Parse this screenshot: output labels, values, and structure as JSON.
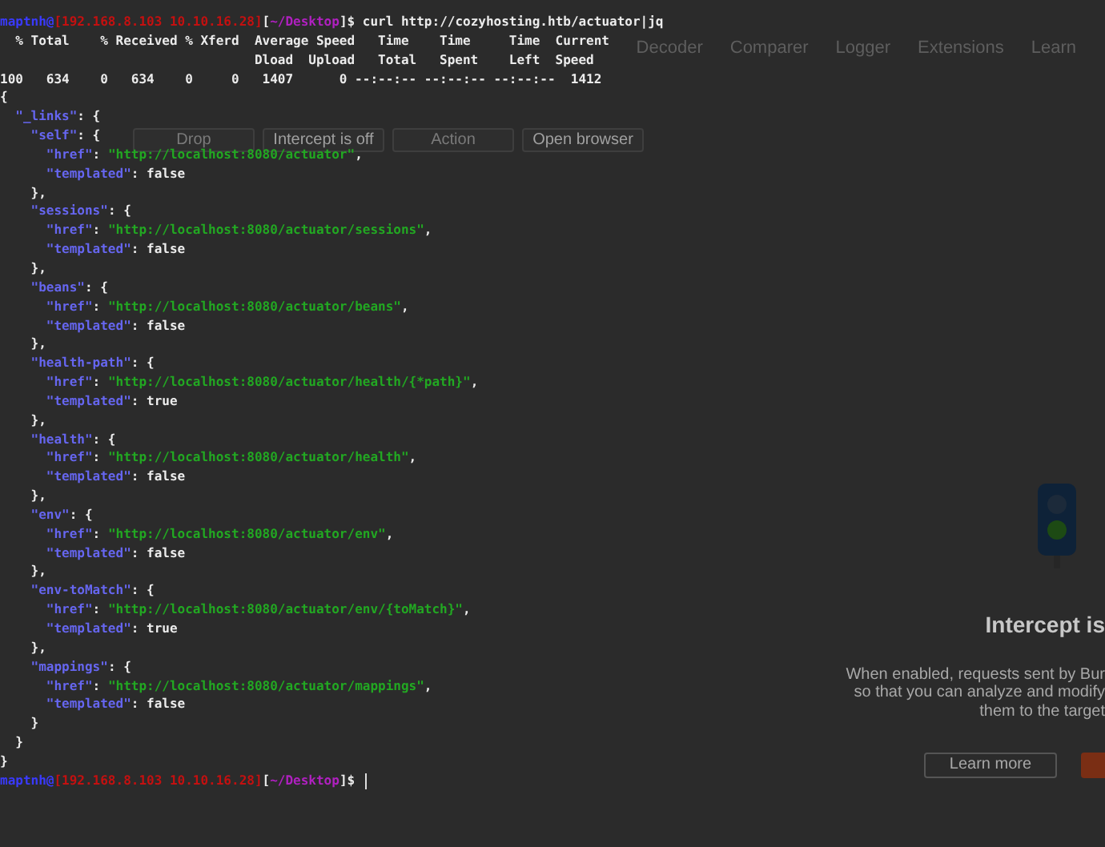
{
  "burp": {
    "tabs": [
      {
        "label": "Decoder",
        "selected": false
      },
      {
        "label": "Comparer",
        "selected": false
      },
      {
        "label": "Logger",
        "selected": false
      },
      {
        "label": "Extensions",
        "selected": false
      },
      {
        "label": "Learn",
        "selected": false
      }
    ],
    "buttons": [
      {
        "label": "Drop",
        "disabled": true
      },
      {
        "label": "Intercept is off",
        "disabled": false
      },
      {
        "label": "Action",
        "disabled": true
      },
      {
        "label": "Open browser",
        "disabled": false
      }
    ],
    "intercept_panel": {
      "title": "Intercept is",
      "description": [
        "When enabled, requests sent by Bur",
        "so that you can analyze and modify",
        "them to the target"
      ],
      "learn_more": "Learn more"
    }
  },
  "terminal": {
    "lines": [
      [
        {
          "kind": "user",
          "text": "maptnh@"
        },
        {
          "kind": "host",
          "text": "[192.168.8.103 10.10.16.28]"
        },
        {
          "kind": "plain",
          "text": "["
        },
        {
          "kind": "path",
          "text": "~/Desktop"
        },
        {
          "kind": "plain",
          "text": "]$ curl http://cozyhosting.htb/actuator|jq"
        }
      ],
      [
        {
          "kind": "plain",
          "text": "  % Total    % Received % Xferd  Average Speed   Time    Time     Time  Current"
        }
      ],
      [
        {
          "kind": "plain",
          "text": "                                 Dload  Upload   Total   Spent    Left  Speed"
        }
      ],
      [
        {
          "kind": "plain",
          "text": "100   634    0   634    0     0   1407      0 --:--:-- --:--:-- --:--:--  1412"
        }
      ],
      [
        {
          "kind": "plain",
          "text": "{"
        }
      ],
      [
        {
          "kind": "key",
          "text": "  \"_links\""
        },
        {
          "kind": "plain",
          "text": ": {"
        }
      ],
      [
        {
          "kind": "key",
          "text": "    \"self\""
        },
        {
          "kind": "plain",
          "text": ": {"
        }
      ],
      [
        {
          "kind": "key",
          "text": "      \"href\""
        },
        {
          "kind": "plain",
          "text": ": "
        },
        {
          "kind": "string",
          "text": "\"http://localhost:8080/actuator\""
        },
        {
          "kind": "plain",
          "text": ","
        }
      ],
      [
        {
          "kind": "key",
          "text": "      \"templated\""
        },
        {
          "kind": "plain",
          "text": ": false"
        }
      ],
      [
        {
          "kind": "plain",
          "text": "    },"
        }
      ],
      [
        {
          "kind": "key",
          "text": "    \"sessions\""
        },
        {
          "kind": "plain",
          "text": ": {"
        }
      ],
      [
        {
          "kind": "key",
          "text": "      \"href\""
        },
        {
          "kind": "plain",
          "text": ": "
        },
        {
          "kind": "string",
          "text": "\"http://localhost:8080/actuator/sessions\""
        },
        {
          "kind": "plain",
          "text": ","
        }
      ],
      [
        {
          "kind": "key",
          "text": "      \"templated\""
        },
        {
          "kind": "plain",
          "text": ": false"
        }
      ],
      [
        {
          "kind": "plain",
          "text": "    },"
        }
      ],
      [
        {
          "kind": "key",
          "text": "    \"beans\""
        },
        {
          "kind": "plain",
          "text": ": {"
        }
      ],
      [
        {
          "kind": "key",
          "text": "      \"href\""
        },
        {
          "kind": "plain",
          "text": ": "
        },
        {
          "kind": "string",
          "text": "\"http://localhost:8080/actuator/beans\""
        },
        {
          "kind": "plain",
          "text": ","
        }
      ],
      [
        {
          "kind": "key",
          "text": "      \"templated\""
        },
        {
          "kind": "plain",
          "text": ": false"
        }
      ],
      [
        {
          "kind": "plain",
          "text": "    },"
        }
      ],
      [
        {
          "kind": "key",
          "text": "    \"health-path\""
        },
        {
          "kind": "plain",
          "text": ": {"
        }
      ],
      [
        {
          "kind": "key",
          "text": "      \"href\""
        },
        {
          "kind": "plain",
          "text": ": "
        },
        {
          "kind": "string",
          "text": "\"http://localhost:8080/actuator/health/{*path}\""
        },
        {
          "kind": "plain",
          "text": ","
        }
      ],
      [
        {
          "kind": "key",
          "text": "      \"templated\""
        },
        {
          "kind": "plain",
          "text": ": true"
        }
      ],
      [
        {
          "kind": "plain",
          "text": "    },"
        }
      ],
      [
        {
          "kind": "key",
          "text": "    \"health\""
        },
        {
          "kind": "plain",
          "text": ": {"
        }
      ],
      [
        {
          "kind": "key",
          "text": "      \"href\""
        },
        {
          "kind": "plain",
          "text": ": "
        },
        {
          "kind": "string",
          "text": "\"http://localhost:8080/actuator/health\""
        },
        {
          "kind": "plain",
          "text": ","
        }
      ],
      [
        {
          "kind": "key",
          "text": "      \"templated\""
        },
        {
          "kind": "plain",
          "text": ": false"
        }
      ],
      [
        {
          "kind": "plain",
          "text": "    },"
        }
      ],
      [
        {
          "kind": "key",
          "text": "    \"env\""
        },
        {
          "kind": "plain",
          "text": ": {"
        }
      ],
      [
        {
          "kind": "key",
          "text": "      \"href\""
        },
        {
          "kind": "plain",
          "text": ": "
        },
        {
          "kind": "string",
          "text": "\"http://localhost:8080/actuator/env\""
        },
        {
          "kind": "plain",
          "text": ","
        }
      ],
      [
        {
          "kind": "key",
          "text": "      \"templated\""
        },
        {
          "kind": "plain",
          "text": ": false"
        }
      ],
      [
        {
          "kind": "plain",
          "text": "    },"
        }
      ],
      [
        {
          "kind": "key",
          "text": "    \"env-toMatch\""
        },
        {
          "kind": "plain",
          "text": ": {"
        }
      ],
      [
        {
          "kind": "key",
          "text": "      \"href\""
        },
        {
          "kind": "plain",
          "text": ": "
        },
        {
          "kind": "string",
          "text": "\"http://localhost:8080/actuator/env/{toMatch}\""
        },
        {
          "kind": "plain",
          "text": ","
        }
      ],
      [
        {
          "kind": "key",
          "text": "      \"templated\""
        },
        {
          "kind": "plain",
          "text": ": true"
        }
      ],
      [
        {
          "kind": "plain",
          "text": "    },"
        }
      ],
      [
        {
          "kind": "key",
          "text": "    \"mappings\""
        },
        {
          "kind": "plain",
          "text": ": {"
        }
      ],
      [
        {
          "kind": "key",
          "text": "      \"href\""
        },
        {
          "kind": "plain",
          "text": ": "
        },
        {
          "kind": "string",
          "text": "\"http://localhost:8080/actuator/mappings\""
        },
        {
          "kind": "plain",
          "text": ","
        }
      ],
      [
        {
          "kind": "key",
          "text": "      \"templated\""
        },
        {
          "kind": "plain",
          "text": ": false"
        }
      ],
      [
        {
          "kind": "plain",
          "text": "    }"
        }
      ],
      [
        {
          "kind": "plain",
          "text": "  }"
        }
      ],
      [
        {
          "kind": "plain",
          "text": "}"
        }
      ],
      [
        {
          "kind": "user",
          "text": "maptnh@"
        },
        {
          "kind": "host",
          "text": "[192.168.8.103 10.10.16.28]"
        },
        {
          "kind": "plain",
          "text": "["
        },
        {
          "kind": "path",
          "text": "~/Desktop"
        },
        {
          "kind": "plain",
          "text": "]$ "
        }
      ]
    ],
    "cursor": true
  }
}
